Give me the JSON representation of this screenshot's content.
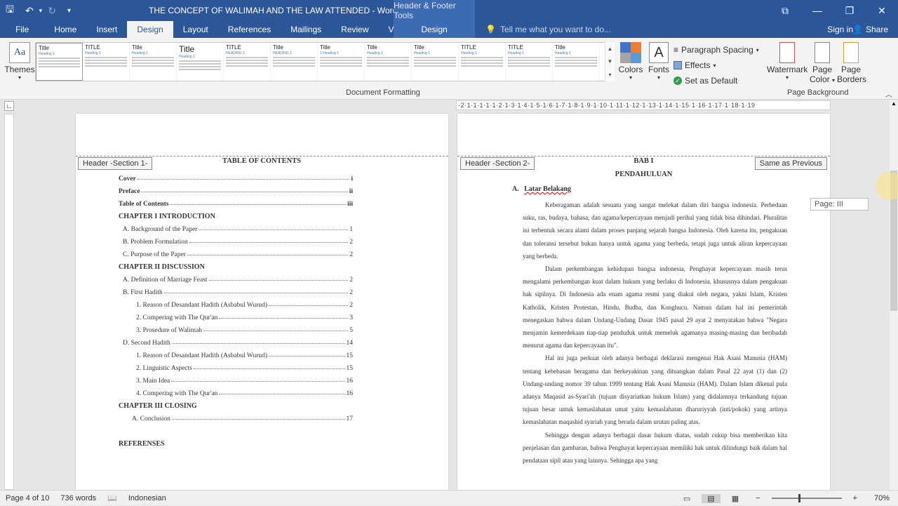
{
  "titlebar": {
    "doc_title": "THE CONCEPT OF WALIMAH AND THE LAW ATTENDED - Word",
    "context_title": "Header & Footer Tools",
    "save_icon": "save-icon",
    "undo_icon": "undo-icon",
    "redo_icon": "redo-icon"
  },
  "tabs": [
    "File",
    "Home",
    "Insert",
    "Design",
    "Layout",
    "References",
    "Mailings",
    "Review",
    "View"
  ],
  "active_tab": "Design",
  "context_tab": "Design",
  "tellme_placeholder": "Tell me what you want to do...",
  "signin": "Sign in",
  "share": "Share",
  "ribbon": {
    "themes": "Themes",
    "colors": "Colors",
    "fonts": "Fonts",
    "paragraph_spacing": "Paragraph Spacing",
    "effects": "Effects",
    "set_default": "Set as Default",
    "document_formatting": "Document Formatting",
    "watermark": "Watermark",
    "page_color_1": "Page",
    "page_color_2": "Color",
    "page_borders_1": "Page",
    "page_borders_2": "Borders",
    "page_background": "Page Background",
    "gallery": [
      {
        "t": "Title",
        "big": false,
        "h": "Heading 1"
      },
      {
        "t": "TITLE",
        "big": false,
        "h": "Heading 1"
      },
      {
        "t": "Title",
        "big": false,
        "h": "Heading 1"
      },
      {
        "t": "Title",
        "big": true,
        "h": "Heading 1"
      },
      {
        "t": "TITLE",
        "big": false,
        "h": "HEADING 1"
      },
      {
        "t": "Title",
        "big": false,
        "h": "HEADING 1"
      },
      {
        "t": "Title",
        "big": false,
        "h": "1 Heading 1"
      },
      {
        "t": "Title",
        "big": false,
        "h": "Heading 1"
      },
      {
        "t": "Title",
        "big": false,
        "h": "Heading 1"
      },
      {
        "t": "TITLE",
        "big": false,
        "h": "Heading 1"
      },
      {
        "t": "TITLE",
        "big": false,
        "h": "Heading 1"
      },
      {
        "t": "Title",
        "big": false,
        "h": "Heading 1"
      }
    ]
  },
  "ruler_text": "·2·1·1·1·1·1·2·1·3·1·4·1·5·1·6·1·7·1·8·1·9·1·10·1·11·1·12·1·13·1·14·1·15·1·16·1·17·1·18·1·19",
  "page1": {
    "header_tag": "Header -Section 1-",
    "heading": "TABLE OF CONTENTS",
    "toc": [
      {
        "kind": "row",
        "label": "Cover",
        "page": "i",
        "bold": true,
        "indent": 0
      },
      {
        "kind": "row",
        "label": "Preface",
        "page": "ii",
        "bold": true,
        "indent": 0
      },
      {
        "kind": "row",
        "label": "Table of Contents",
        "page": "iii",
        "bold": true,
        "indent": 0
      },
      {
        "kind": "chap",
        "label": "CHAPTER I  INTRODUCTION"
      },
      {
        "kind": "row",
        "label": "A. Background of the Paper",
        "page": "1",
        "bold": false,
        "indent": 6
      },
      {
        "kind": "row",
        "label": "B. Problem Formulation",
        "page": "2",
        "bold": false,
        "indent": 6
      },
      {
        "kind": "row",
        "label": "C. Purpose of the Paper",
        "page": "2",
        "bold": false,
        "indent": 6
      },
      {
        "kind": "chap",
        "label": "CHAPTER II  DISCUSSION"
      },
      {
        "kind": "row",
        "label": "A. Definition of Marriage Feast",
        "page": "2",
        "bold": false,
        "indent": 6
      },
      {
        "kind": "row",
        "label": "B. First Hadith",
        "page": "2",
        "bold": false,
        "indent": 6
      },
      {
        "kind": "row",
        "label": "1. Reason of Desandant Hadith (Asbabul Wurud)",
        "page": "2",
        "bold": false,
        "indent": 25
      },
      {
        "kind": "row",
        "label": "2. Compering with The Qur'an",
        "page": "3",
        "bold": false,
        "indent": 25
      },
      {
        "kind": "row",
        "label": "3. Prosedure of Walimah",
        "page": "5",
        "bold": false,
        "indent": 25
      },
      {
        "kind": "row",
        "label": "D. Second Hadith",
        "page": "14",
        "bold": false,
        "indent": 6
      },
      {
        "kind": "row",
        "label": "1. Reason of Desandant Hadith (Asbabul Wurud)",
        "page": "15",
        "bold": false,
        "indent": 25
      },
      {
        "kind": "row",
        "label": "2. Linguistic Aspects",
        "page": "15",
        "bold": false,
        "indent": 25
      },
      {
        "kind": "row",
        "label": "3. Main Idea",
        "page": "16",
        "bold": false,
        "indent": 25
      },
      {
        "kind": "row",
        "label": "4. Compering with The Qur'an",
        "page": "16",
        "bold": false,
        "indent": 25
      },
      {
        "kind": "chap",
        "label": "CHAPTER III CLOSING"
      },
      {
        "kind": "row",
        "label": "A. Conclusion",
        "page": "17",
        "bold": false,
        "indent": 19
      },
      {
        "kind": "space"
      },
      {
        "kind": "chap",
        "label": "REFERENSES"
      }
    ]
  },
  "page2": {
    "header_tag": "Header -Section 2-",
    "same_as_previous": "Same as Previous",
    "bab": "BAB I",
    "title": "PENDAHULUAN",
    "sub_letter": "A.",
    "sub_title": "Latar Belakang",
    "paragraphs": [
      "Keberagaman adalah sesuatu yang sangat melekat dalam diri bangsa indonesia. Perbedaan suku, ras, budaya, bahasa, dan agama/kepercayaan menjadi perihal yang tidak bisa dihindari. Pluralitas ini terbentuk secara alami dalam proses panjang sejarah bangsa Indonesia. Oleh karena itu, pengakuan dan toleransi tersebut bukan hanya untuk agama yang berbeda, tetapi juga untuk aliran kepercayaan yang berbeda.",
      "Dalam perkembangan kehidupan bangsa indonesia, Penghayat kepercayaan masih terus mengalami perkembangan kuat dalam hukum yang berlaku di Indonesia, khususnya dalam pengakuan hak sipilnya. Di Indonesia ada enam agama resmi yang diakui oleh negara, yakni Islam, Kristen Katholik, Kristen Protestan, Hindu, Budha, dan Konghucu. Namun dalam hal ini pemerintah menegaskan bahwa dalam Undang-Undang Dasar 1945 pasal 29 ayat 2 menyatakan bahwa \"Negara menjamin kemerdekaan tiap-tiap penduduk untuk memeluk agamanya masing-masing dan beribadah menurut agama dan kepercayaan itu\".",
      "Hal ini juga perkuat oleh adanya berbagai deklarasi mengenai Hak Asasi Manusia (HAM) tentang kebebasan beragama dan berkeyakinan yang dituangkan dalam Pasal 22 ayat (1) dan (2) Undang-undang nomor 39 tahun 1999 tentang Hak Asasi Manusia (HAM). Dalam Islam dikenal pula adanya Maqasid as-Syari'ah (tujuan disyariatkan hukum Islam) yang didalamnya terkandung tujuan tujuan besar untuk kemaslahatan umat yaitu kemaslahatan dharuriyyah (inti/pokok) yang artinya kemaslahatan maqashid syariah yang berada dalam urutan paling atas.",
      "Sehingga dengan adanya berbagai dasar hukum diatas, sudah cukup bisa memberikan kita penjelasan dan gambaran, bahwa Penghayat kepercayaan memiliki hak untuk dilindungi baik dalam hal pendataan sipil atau yang lainnya. Sehingga apa yang"
    ],
    "page_label": "Page: III"
  },
  "status": {
    "page": "Page 4 of 10",
    "words": "736 words",
    "language": "Indonesian",
    "zoom": "70%",
    "zoom_minus": "−",
    "zoom_plus": "+"
  }
}
